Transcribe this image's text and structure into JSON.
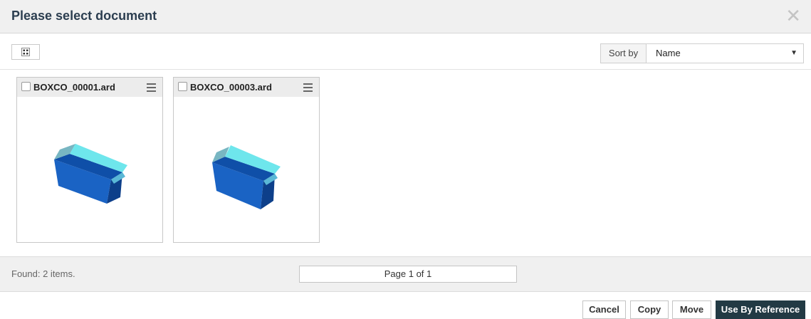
{
  "dialog": {
    "title": "Please select document",
    "close_glyph": "✕"
  },
  "toolbar": {
    "view_icon": "grid-view-icon",
    "sort_label": "Sort by",
    "sort_value": "Name",
    "sort_arrow": "▼"
  },
  "documents": [
    {
      "name": "BOXCO_00001.ard",
      "thumbnail": "open-box-3d-icon"
    },
    {
      "name": "BOXCO_00003.ard",
      "thumbnail": "open-box-3d-icon"
    }
  ],
  "footer": {
    "status": "Found: 2 items.",
    "pager": "Page 1 of 1"
  },
  "actions": {
    "cancel": "Cancel",
    "copy": "Copy",
    "move": "Move",
    "use_by_reference": "Use By Reference"
  },
  "colors": {
    "primary_button": "#223a44",
    "box_blue": "#1a63c4",
    "box_cyan": "#6ee6ec"
  }
}
